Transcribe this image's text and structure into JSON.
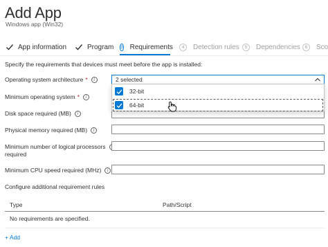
{
  "header": {
    "title": "Add App",
    "subtitle": "Windows app (Win32)"
  },
  "steps": [
    {
      "label": "App information",
      "state": "complete"
    },
    {
      "label": "Program",
      "state": "complete"
    },
    {
      "number": "3",
      "label": "Requirements",
      "state": "active"
    },
    {
      "number": "4",
      "label": "Detection rules",
      "state": "disabled"
    },
    {
      "number": "5",
      "label": "Dependencies",
      "state": "disabled"
    },
    {
      "number": "6",
      "label": "Scope",
      "state": "disabled"
    }
  ],
  "intro": "Specify the requirements that devices must meet before the app is installed:",
  "fields": {
    "os_architecture": {
      "label": "Operating system architecture",
      "required": "*",
      "value": "2 selected"
    },
    "min_os": {
      "label": "Minimum operating system",
      "required": "*"
    },
    "disk_space": {
      "label": "Disk space required (MB)",
      "value": ""
    },
    "physical_memory": {
      "label": "Physical memory required (MB)",
      "value": ""
    },
    "logical_processors": {
      "label_line1": "Minimum number of logical processors",
      "label_line2": "required",
      "value": ""
    },
    "cpu_speed": {
      "label": "Minimum CPU speed required (MHz)",
      "value": ""
    }
  },
  "dropdown_options": [
    {
      "label": "32-bit",
      "checked": true
    },
    {
      "label": "64-bit",
      "checked": true
    }
  ],
  "additional_rules": {
    "heading": "Configure additional requirement rules",
    "columns": [
      "Type",
      "Path/Script"
    ],
    "empty_message": "No requirements are specified.",
    "add_label": "+ Add"
  },
  "icons": {
    "info": "i",
    "check": "check-icon",
    "chevron": "chevron-up-icon"
  },
  "colors": {
    "accent": "#0078d4",
    "required": "#a4262c",
    "text": "#323130",
    "muted": "#605e5c",
    "disabled": "#a19f9d"
  }
}
